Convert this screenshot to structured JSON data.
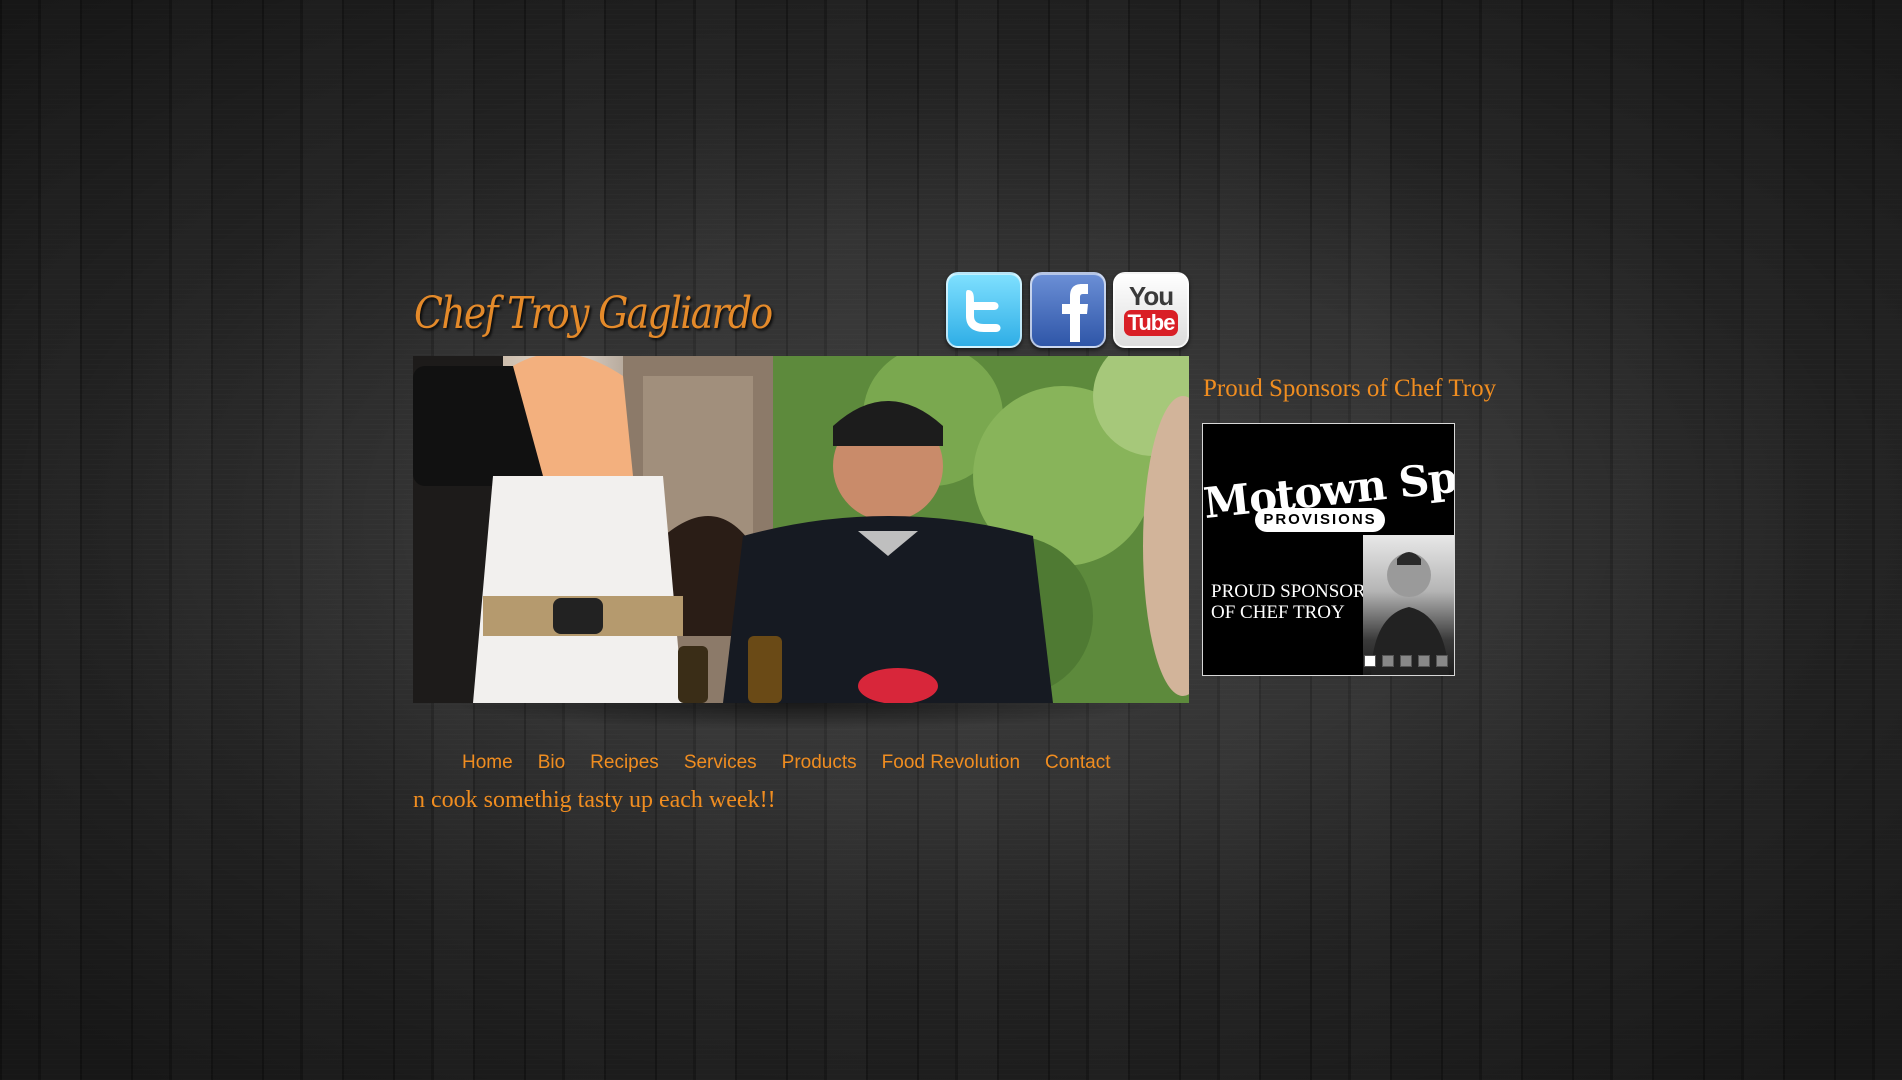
{
  "header": {
    "logo_text": "Chef Troy Gagliardo"
  },
  "social": [
    {
      "name": "Twitter",
      "icon": "twitter-icon",
      "color": "#2faee6"
    },
    {
      "name": "Facebook",
      "icon": "facebook-icon",
      "color": "#3b5998"
    },
    {
      "name": "YouTube",
      "icon": "youtube-icon",
      "color": "#d91f26",
      "you_label": "You",
      "tube_label": "Tube"
    }
  ],
  "nav": {
    "items": [
      "Home",
      "Bio",
      "Recipes",
      "Services",
      "Products",
      "Food Revolution",
      "Contact"
    ]
  },
  "marquee": {
    "text": "n cook somethig tasty up each week!!"
  },
  "sponsors": {
    "heading": "Proud Sponsors of Chef Troy",
    "banner": {
      "brand": "Motown Spice",
      "sub": "PROVISIONS",
      "line1": "PROUD SPONSORS",
      "line2": "OF CHEF TROY",
      "slide_count": 5,
      "active_slide": 1
    }
  },
  "colors": {
    "accent": "#f08d20",
    "background": "#262626"
  }
}
